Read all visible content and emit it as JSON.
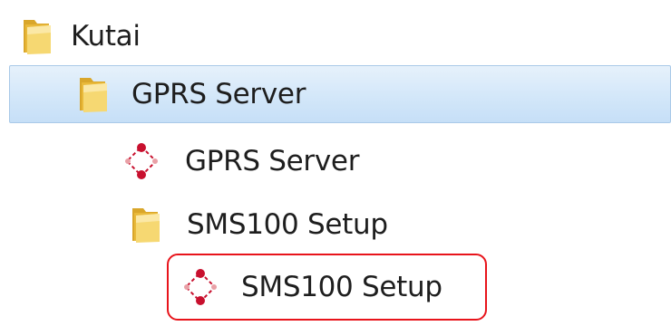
{
  "tree": {
    "items": [
      {
        "label": "Kutai",
        "icon": "folder-icon"
      },
      {
        "label": "GPRS Server",
        "icon": "folder-icon",
        "selected": true
      },
      {
        "label": "GPRS Server",
        "icon": "app-shortcut-icon"
      },
      {
        "label": "SMS100 Setup",
        "icon": "folder-icon"
      },
      {
        "label": "SMS100 Setup",
        "icon": "app-shortcut-icon",
        "highlighted": true
      }
    ]
  },
  "colors": {
    "selection_background": "#d3e7f9",
    "selection_border": "#a9c9e8",
    "highlight_border": "#e8141b",
    "folder_yellow": "#f2c94c",
    "shortcut_red": "#c8102e"
  }
}
